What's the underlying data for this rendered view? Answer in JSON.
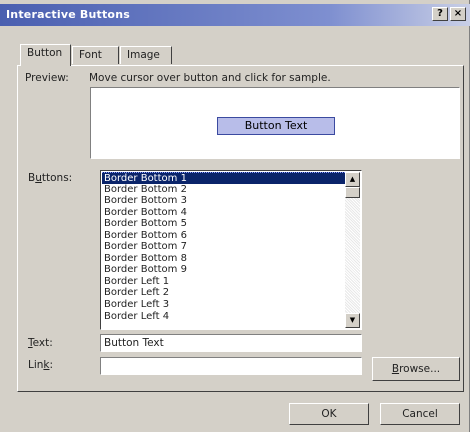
{
  "window": {
    "title": "Interactive Buttons",
    "help_glyph": "?",
    "close_glyph": "×"
  },
  "tabs": [
    {
      "label": "Button",
      "active": true
    },
    {
      "label": "Font",
      "active": false
    },
    {
      "label": "Image",
      "active": false
    }
  ],
  "preview": {
    "label": "Preview:",
    "instructions": "Move cursor over button and click for sample.",
    "sample_button_text": "Button Text"
  },
  "buttons_list": {
    "label_pre": "B",
    "label_accel": "u",
    "label_post": "ttons:",
    "selected_index": 0,
    "items": [
      "Border Bottom 1",
      "Border Bottom 2",
      "Border Bottom 3",
      "Border Bottom 4",
      "Border Bottom 5",
      "Border Bottom 6",
      "Border Bottom 7",
      "Border Bottom 8",
      "Border Bottom 9",
      "Border Left 1",
      "Border Left 2",
      "Border Left 3",
      "Border Left 4"
    ],
    "scroll_up_glyph": "▲",
    "scroll_down_glyph": "▼"
  },
  "text_field": {
    "label_accel": "T",
    "label_post": "ext:",
    "value": "Button Text"
  },
  "link_field": {
    "label_pre": "Lin",
    "label_accel": "k",
    "label_post": ":",
    "value": ""
  },
  "browse_button": {
    "label_accel": "B",
    "label_post": "rowse..."
  },
  "ok_button": {
    "label": "OK"
  },
  "cancel_button": {
    "label": "Cancel"
  }
}
